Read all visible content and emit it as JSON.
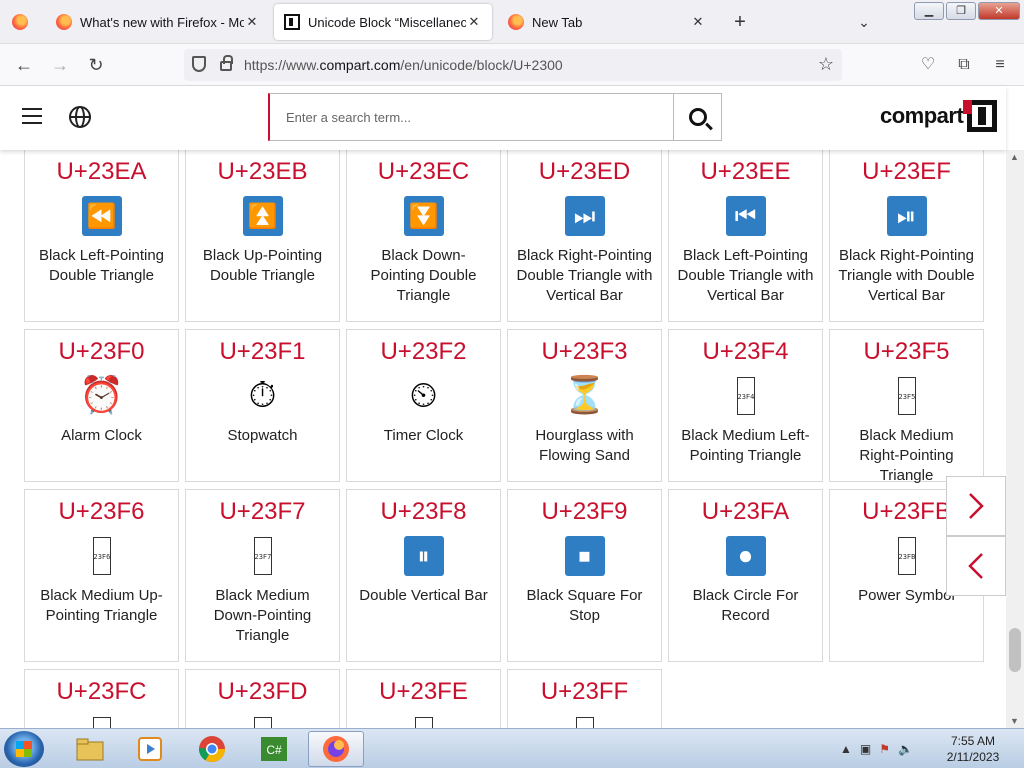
{
  "browser": {
    "tabs": [
      {
        "title": "What's new with Firefox - More",
        "icon": "firefox-icon",
        "active": false
      },
      {
        "title": "Unicode Block “Miscellaneous T",
        "icon": "compart-icon",
        "active": true
      },
      {
        "title": "New Tab",
        "icon": "firefox-icon",
        "active": false
      }
    ],
    "new_tab_label": "+",
    "url_prefix": "https://www.",
    "url_domain": "compart.com",
    "url_path": "/en/unicode/block/U+2300"
  },
  "site": {
    "search_placeholder": "Enter a search term...",
    "logo_text": "compart"
  },
  "cells": [
    {
      "code": "U+23EA",
      "name": "Black Left-Pointing Double Triangle",
      "glyph": "⏪",
      "style": "blue"
    },
    {
      "code": "U+23EB",
      "name": "Black Up-Pointing Double Triangle",
      "glyph": "⏫",
      "style": "blue"
    },
    {
      "code": "U+23EC",
      "name": "Black Down-Pointing Double Triangle",
      "glyph": "⏬",
      "style": "blue"
    },
    {
      "code": "U+23ED",
      "name": "Black Right-Pointing Double Triangle with Vertical Bar",
      "glyph": "⏭",
      "style": "blue"
    },
    {
      "code": "U+23EE",
      "name": "Black Left-Pointing Double Triangle with Vertical Bar",
      "glyph": "⏮",
      "style": "blue"
    },
    {
      "code": "U+23EF",
      "name": "Black Right-Pointing Triangle with Double Vertical Bar",
      "glyph": "⏯",
      "style": "blue"
    },
    {
      "code": "U+23F0",
      "name": "Alarm Clock",
      "glyph": "⏰",
      "style": "emoji"
    },
    {
      "code": "U+23F1",
      "name": "Stopwatch",
      "glyph": "⏱",
      "style": "emoji"
    },
    {
      "code": "U+23F2",
      "name": "Timer Clock",
      "glyph": "⏲",
      "style": "emoji"
    },
    {
      "code": "U+23F3",
      "name": "Hourglass with Flowing Sand",
      "glyph": "⏳",
      "style": "emoji"
    },
    {
      "code": "U+23F4",
      "name": "Black Medium Left-Pointing Triangle",
      "glyph": "23F4",
      "style": "tofu"
    },
    {
      "code": "U+23F5",
      "name": "Black Medium Right-Pointing Triangle",
      "glyph": "23F5",
      "style": "tofu"
    },
    {
      "code": "U+23F6",
      "name": "Black Medium Up-Pointing Triangle",
      "glyph": "23F6",
      "style": "tofu"
    },
    {
      "code": "U+23F7",
      "name": "Black Medium Down-Pointing Triangle",
      "glyph": "23F7",
      "style": "tofu"
    },
    {
      "code": "U+23F8",
      "name": "Double Vertical Bar",
      "glyph": "⏸",
      "style": "blue"
    },
    {
      "code": "U+23F9",
      "name": "Black Square For Stop",
      "glyph": "⏹",
      "style": "blue"
    },
    {
      "code": "U+23FA",
      "name": "Black Circle For Record",
      "glyph": "⏺",
      "style": "blue"
    },
    {
      "code": "U+23FB",
      "name": "Power Symbol",
      "glyph": "23FB",
      "style": "tofu"
    },
    {
      "code": "U+23FC",
      "name": "",
      "glyph": "",
      "style": "tofu"
    },
    {
      "code": "U+23FD",
      "name": "",
      "glyph": "",
      "style": "tofu"
    },
    {
      "code": "U+23FE",
      "name": "",
      "glyph": "",
      "style": "tofu"
    },
    {
      "code": "U+23FF",
      "name": "",
      "glyph": "",
      "style": "tofu"
    }
  ],
  "nav_arrows": {
    "next": "›",
    "prev": "‹"
  },
  "taskbar": {
    "items": [
      "windows-explorer-icon",
      "media-player-icon",
      "chrome-icon",
      "csharp-icon",
      "firefox-icon"
    ],
    "time": "7:55 AM",
    "date": "2/11/2023"
  },
  "colors": {
    "accent": "#c8102e",
    "icon_blue": "#2f7ec4"
  }
}
